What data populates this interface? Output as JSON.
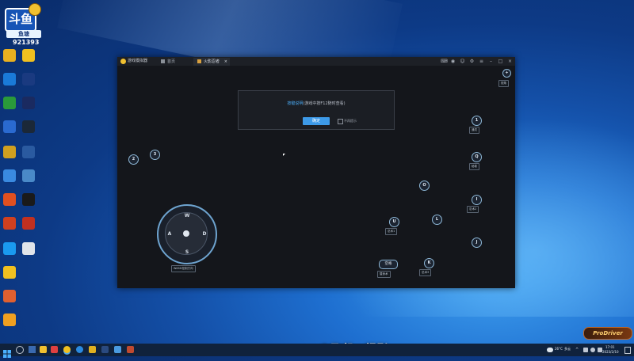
{
  "badge": {
    "logo_text": "斗鱼",
    "pill_text": "鱼塘",
    "room_number": "921393"
  },
  "desktop_icons": [
    {
      "label": "",
      "color": "#e8b020"
    },
    {
      "label": "",
      "color": "#f0c020"
    },
    {
      "label": "",
      "color": "#1a7ad8"
    },
    {
      "label": "",
      "color": "#1a3a80"
    },
    {
      "label": "",
      "color": "#2a9a3a"
    },
    {
      "label": "",
      "color": "#1a2a60"
    },
    {
      "label": "",
      "color": "#2a6ad0"
    },
    {
      "label": "",
      "color": "#1b2838"
    },
    {
      "label": "",
      "color": "#d0a020"
    },
    {
      "label": "",
      "color": "#2a5aa0"
    },
    {
      "label": "",
      "color": "#3a8ae0"
    },
    {
      "label": "",
      "color": "#4a8ac8"
    },
    {
      "label": "",
      "color": "#e05020"
    },
    {
      "label": "",
      "color": "#1a1a1a"
    },
    {
      "label": "",
      "color": "#d04020"
    },
    {
      "label": "",
      "color": "#c03020"
    },
    {
      "label": "",
      "color": "#1a9af0"
    },
    {
      "label": "",
      "color": "#e0e4ea"
    },
    {
      "label": "",
      "color": "#f0c020"
    },
    {
      "label": "",
      "color": "#e06030"
    },
    {
      "label": "",
      "color": "#f0a020"
    }
  ],
  "emulator": {
    "app_name": "游戏模拟器",
    "tabs": [
      {
        "label": "首页"
      },
      {
        "label": "火影忍者"
      }
    ],
    "dialog": {
      "message_highlight": "按键说明",
      "message_rest": "(游戏中按F12随时查看)",
      "ok_label": "确定",
      "checkbox_label": "不再提示"
    },
    "keys": {
      "key_2_left": "2",
      "key_3": "3",
      "key_1": "1",
      "key_1_label": "通灵",
      "key_q": "Q",
      "key_q_label": "秘卷",
      "key_o": "O",
      "key_i": "I",
      "key_i_label": "忍术2",
      "key_u": "U",
      "key_u_label": "忍术1",
      "key_l": "L",
      "key_j": "J",
      "key_space": "空格",
      "key_space_label": "替身术",
      "key_k": "K",
      "key_k_label": "忍术3",
      "top_right_label": "视角"
    },
    "dpad": {
      "up": "W",
      "left": "A",
      "down": "S",
      "right": "D",
      "label": "WASD控制方向"
    }
  },
  "taskbar": {
    "weather": "26°C",
    "weather_note": "多云",
    "time": "17:01",
    "date": "2023/2/10"
  },
  "watermark": "2飞机=超影",
  "prodriver": "ProDriver"
}
